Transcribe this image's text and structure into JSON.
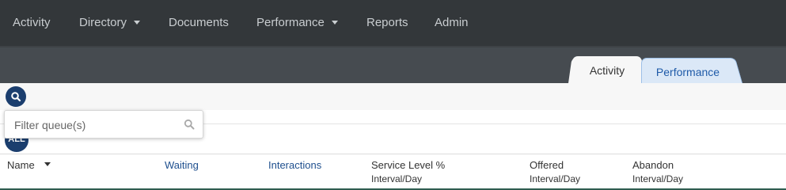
{
  "nav": {
    "items": [
      {
        "label": "Activity",
        "dropdown": false
      },
      {
        "label": "Directory",
        "dropdown": true
      },
      {
        "label": "Documents",
        "dropdown": false
      },
      {
        "label": "Performance",
        "dropdown": true
      },
      {
        "label": "Reports",
        "dropdown": false
      },
      {
        "label": "Admin",
        "dropdown": false
      }
    ]
  },
  "tabs": [
    {
      "label": "Activity",
      "selected": false
    },
    {
      "label": "Performance",
      "selected": true
    }
  ],
  "filter": {
    "placeholder": "Filter queue(s)",
    "value": "",
    "all_label": "ALL"
  },
  "table": {
    "columns": [
      {
        "label": "Name",
        "sub": "",
        "sortable": true
      },
      {
        "label": "Waiting",
        "sub": ""
      },
      {
        "label": "Interactions",
        "sub": ""
      },
      {
        "label": "Service Level %",
        "sub": "Interval/Day"
      },
      {
        "label": "Offered",
        "sub": "Interval/Day"
      },
      {
        "label": "Abandon",
        "sub": "Interval/Day"
      }
    ]
  },
  "colors": {
    "navbar_bg": "#33373a",
    "tabbar_bg": "#464b50",
    "accent": "#1b3e6e",
    "tab_selected_bg": "#dbe8f7",
    "link": "#1e4f8e"
  },
  "icons": [
    "chevron-down-icon",
    "search-icon",
    "magnifier-icon",
    "sort-down-icon"
  ]
}
